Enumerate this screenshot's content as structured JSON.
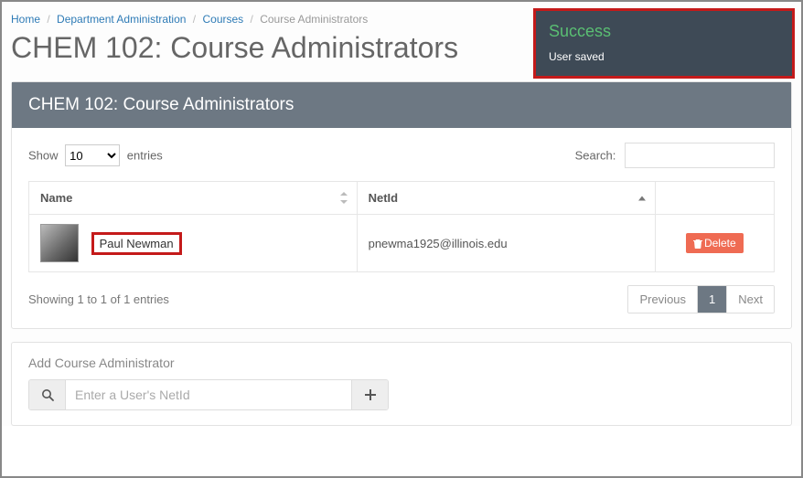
{
  "breadcrumb": {
    "home": "Home",
    "dept": "Department Administration",
    "courses": "Courses",
    "current": "Course Administrators"
  },
  "page_title": "CHEM 102: Course Administrators",
  "panel_title": "CHEM 102: Course Administrators",
  "length": {
    "show": "Show",
    "entries": "entries",
    "value": "10"
  },
  "search": {
    "label": "Search:"
  },
  "columns": {
    "name": "Name",
    "netid": "NetId",
    "actions": ""
  },
  "rows": [
    {
      "name": "Paul Newman",
      "netid": "pnewma1925@illinois.edu"
    }
  ],
  "delete_label": "Delete",
  "info": "Showing 1 to 1 of 1 entries",
  "paginator": {
    "prev": "Previous",
    "page": "1",
    "next": "Next"
  },
  "add": {
    "title": "Add Course Administrator",
    "placeholder": "Enter a User's NetId"
  },
  "toast": {
    "title": "Success",
    "body": "User saved"
  }
}
